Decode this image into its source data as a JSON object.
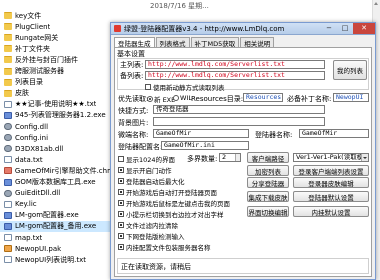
{
  "explorer": {
    "date_text": "2018/7/16 星期...",
    "date_text2": "...",
    "files": [
      {
        "name": "key文件",
        "icon": "folder-icon"
      },
      {
        "name": "PlugClient",
        "icon": "folder-icon"
      },
      {
        "name": "Rungate网关",
        "icon": "folder-icon"
      },
      {
        "name": "补丁文件夹",
        "icon": "folder-icon"
      },
      {
        "name": "反外挂与封百门插件",
        "icon": "folder-icon"
      },
      {
        "name": "跨服测试服务器",
        "icon": "folder-icon"
      },
      {
        "name": "列表目录",
        "icon": "folder-icon"
      },
      {
        "name": "皮肤",
        "icon": "folder-icon"
      },
      {
        "name": "★★记事-使用说明★★.txt",
        "icon": "document-icon"
      },
      {
        "name": "945-列表管理服务器1.2.exe",
        "icon": "app-icon"
      },
      {
        "name": "Config.dll",
        "icon": "gear-icon"
      },
      {
        "name": "Config.ini",
        "icon": "gear-icon"
      },
      {
        "name": "D3DX81ab.dll",
        "icon": "gear-icon"
      },
      {
        "name": "data.txt",
        "icon": "document-icon"
      },
      {
        "name": "GameOfMir引擎帮助文件.chm",
        "icon": "image-icon"
      },
      {
        "name": "GOM版本数据库工具.exe",
        "icon": "app-icon"
      },
      {
        "name": "GuiEditDll.dll",
        "icon": "gear-icon"
      },
      {
        "name": "Key.lic",
        "icon": "document-icon"
      },
      {
        "name": "LM-gom配置器.exe",
        "icon": "app-icon"
      },
      {
        "name": "LM-gom配置器_备用.exe",
        "icon": "app-icon"
      },
      {
        "name": "map.txt",
        "icon": "document-icon"
      },
      {
        "name": "NewopUI.pak",
        "icon": "library-icon"
      },
      {
        "name": "NewopUI列表说明.txt",
        "icon": "document-icon"
      }
    ]
  },
  "dialog": {
    "title": "绿盟·登陆器配置器v3.4 - http://www.LmDlq.com",
    "tabs": [
      "登陆器生成",
      "列表格式",
      "补丁MD5获取",
      "相关说明"
    ],
    "basic_settings": "基本设置",
    "main_list_label": "主列表:",
    "main_list_value": "http://www.lmdlq.com/Serverlist.txt",
    "backup_list_label": "备列表:",
    "backup_list_value": "http://www.lmdlq.com/Serverlist.txt",
    "my_list_button": "我的列表",
    "encrypt_checkbox": "使用新动静方式读取列表",
    "priority_label": "优先读取:",
    "radio_default": "新 EXE",
    "radio_wil": "WIL",
    "resources_label": "Resources目录:",
    "resources_value": "Resources",
    "required_patch_label": "必备补丁名称:",
    "required_patch_value": "NewopUI",
    "shortcut_label": "快捷方式:",
    "shortcut_value": "传奇登陆器",
    "background_label": "背景图片:",
    "background_value": "",
    "micro_end_label": "微端名称:",
    "micro_end_value": "GameOfMir",
    "launcher_name_label": "登陆器名称:",
    "launcher_name_value": "GameOfMir",
    "config_name_label": "登陆器配置名:",
    "config_name_value": "GameOfMir.ini",
    "show_skin_check": "显示1024的界面",
    "count_label": "多界数量:",
    "count_value": "2",
    "client_install_button": "客户端路径",
    "version_dropdown": "Ver1-Ver1-Pak(读取模组)",
    "show_launch_check": "显示开启门动作",
    "add_list_button": "加密列表",
    "login_list_button": "登录客户端端列表设置",
    "close_after_check": "登陆器启动后最大化",
    "open_start_check": "开始游戏后自动打开登陆器页面",
    "anti_swap_check": "开始游戏后鼠标是左键点击我的页面",
    "small_tip_check": "小提示栏切换到右边拉才对出字样",
    "list_server_button": "分享登陆器",
    "skin_setting_button": "登录器皮肤编辑",
    "md5_check": "文件过滤内拉清除",
    "integrate_button": "集成下载皮肤",
    "launcher_default_button": "登陆器默认设置",
    "auto_update_check": "下网登陆版检测输入",
    "url_output_check": "内挂配置文件包装服务器名称",
    "page_button": "界面切换编辑",
    "internal_settings_button": "内挂默认设置",
    "status_label": "正在读取资源，请稍后"
  }
}
